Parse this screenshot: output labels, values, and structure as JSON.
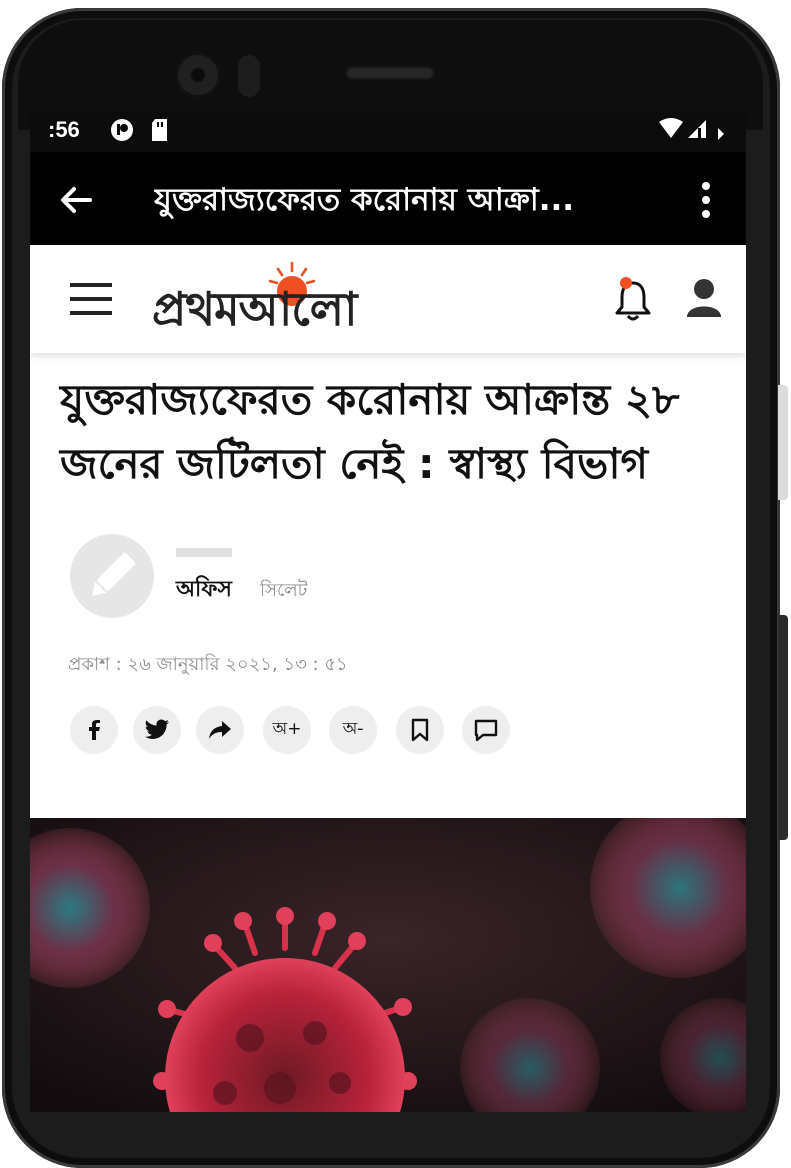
{
  "statusbar": {
    "time": ":56"
  },
  "toolbar": {
    "title": "যুক্তরাজ্যফেরত করোনায় আক্রা..."
  },
  "site": {
    "logo_text": "প্রথমআলো",
    "notification_dot_color": "#f04e23"
  },
  "article": {
    "headline_line1": "যুক্তরাজ্যফেরত করোনায় আক্রান্ত ২৮",
    "headline_line2": "জনের জটিলতা নেই : স্বাস্থ্য বিভাগ",
    "author": "অফিস",
    "location": "সিলেট",
    "published": "প্রকাশ : ২৬ জানুয়ারি ২০২১, ১৩ : ৫১"
  },
  "actions": {
    "font_increase": "অ+",
    "font_decrease": "অ-"
  },
  "colors": {
    "accent": "#f04e23",
    "toolbar_bg": "#000000",
    "virus_red": "#c8283a",
    "virus_teal": "#2d8c96"
  }
}
